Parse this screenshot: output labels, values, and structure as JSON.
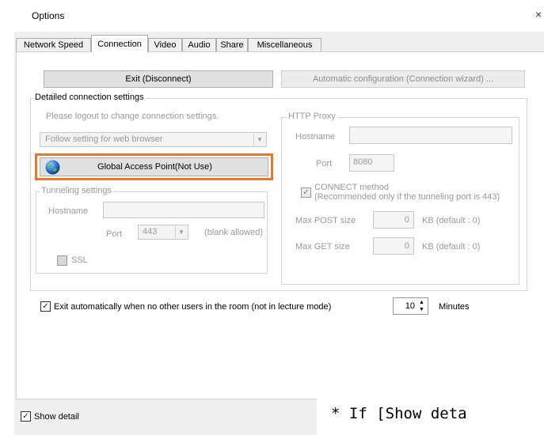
{
  "window": {
    "title": "Options",
    "close_glyph": "×"
  },
  "tabs": [
    {
      "label": "Network Speed",
      "active": false
    },
    {
      "label": "Connection",
      "active": true
    },
    {
      "label": "Video",
      "active": false
    },
    {
      "label": "Audio",
      "active": false
    },
    {
      "label": "Share",
      "active": false
    },
    {
      "label": "Miscellaneous",
      "active": false
    }
  ],
  "buttons": {
    "exit": "Exit (Disconnect)",
    "auto_config": "Automatic configuration (Connection wizard) ..."
  },
  "detailed": {
    "legend": "Detailed connection settings",
    "note": "Please logout to change connection settings.",
    "browser_setting": "Follow setting for web browser",
    "global_access": "Global Access Point(Not Use)"
  },
  "tunneling": {
    "legend": "Tunneling settings",
    "hostname_label": "Hostname",
    "hostname_value": "",
    "port_label": "Port",
    "port_value": "443",
    "blank_allowed": "(blank allowed)",
    "ssl_label": "SSL",
    "ssl_checked": false
  },
  "proxy": {
    "legend": "HTTP Proxy",
    "hostname_label": "Hostname",
    "hostname_value": "",
    "port_label": "Port",
    "port_value": "8080",
    "connect_label": "CONNECT method",
    "connect_note": "(Recommended only if the tunneling port is 443)",
    "connect_checked": true,
    "max_post_label": "Max POST size",
    "max_post_value": "0",
    "max_post_unit": "KB (default : 0)",
    "max_get_label": "Max GET size",
    "max_get_value": "0",
    "max_get_unit": "KB (default : 0)"
  },
  "auto_exit": {
    "label": "Exit automatically when no other users in the room (not in lecture mode)",
    "checked": true,
    "minutes_value": "10",
    "minutes_label": "Minutes"
  },
  "footer": {
    "show_detail_label": "Show detail",
    "show_detail_checked": true,
    "check_glyph": "✓"
  },
  "overlay_note": "* If [Show deta"
}
